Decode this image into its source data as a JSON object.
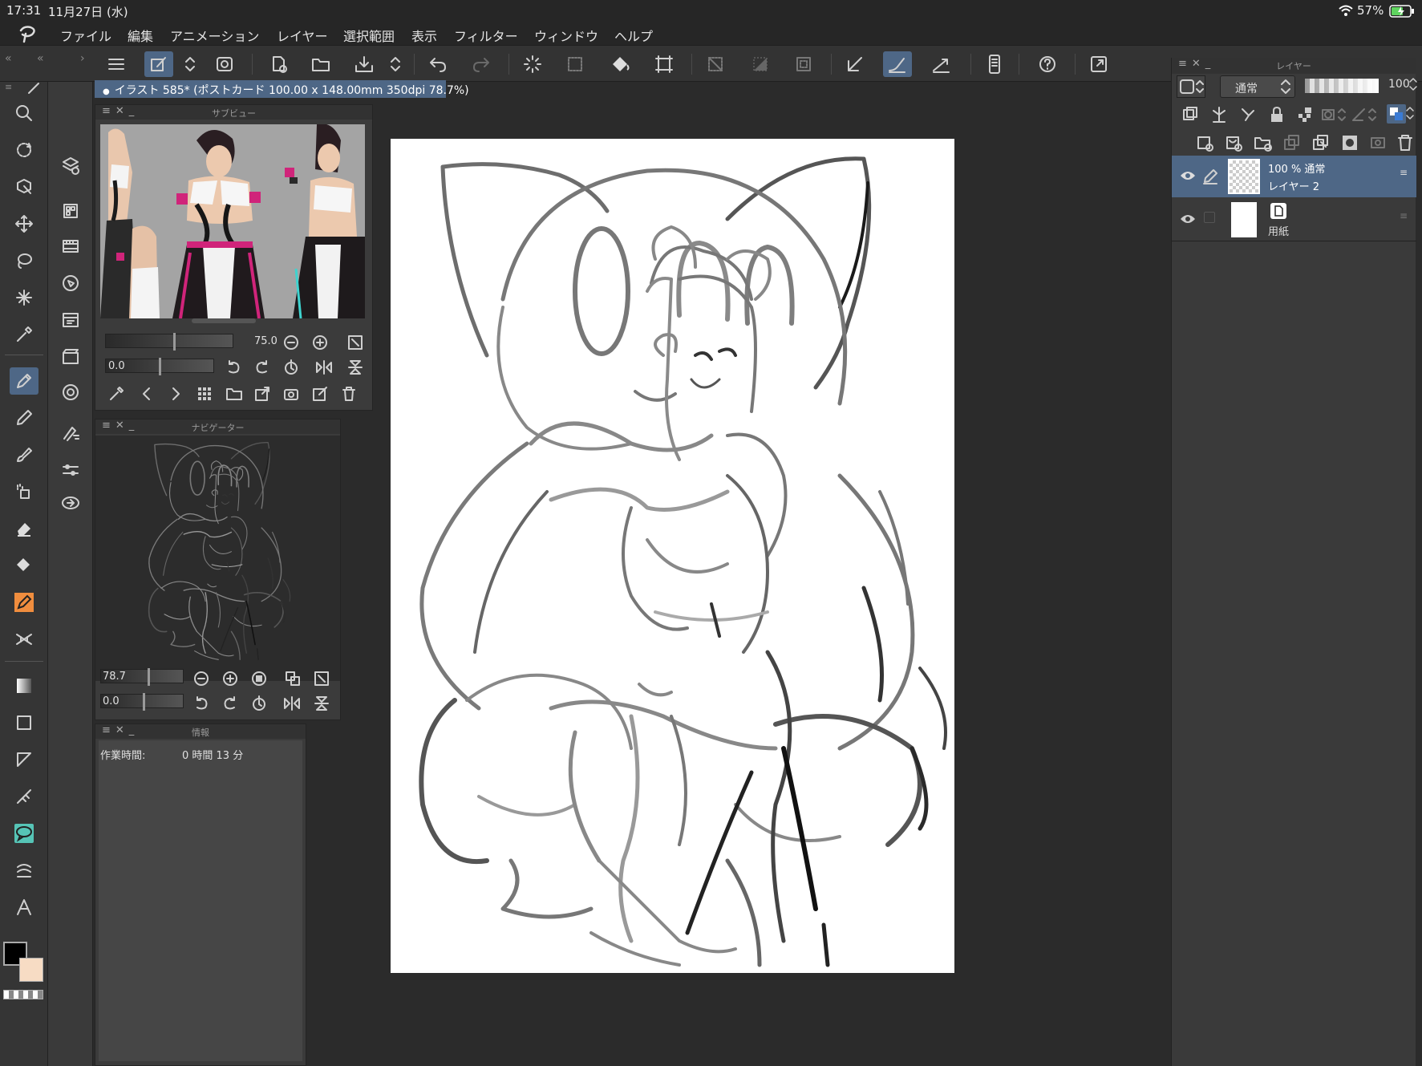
{
  "status": {
    "time": "17:31",
    "date": "11月27日 (水)",
    "battery": "57%"
  },
  "menu": [
    "ファイル",
    "編集",
    "アニメーション",
    "レイヤー",
    "選択範囲",
    "表示",
    "フィルター",
    "ウィンドウ",
    "ヘルプ"
  ],
  "document": {
    "tab_title": "イラスト 585* (ポストカード 100.00 x 148.00mm 350dpi 78.7%)"
  },
  "subview": {
    "title": "サブビュー",
    "zoom": "75.0",
    "rotation": "0.0"
  },
  "navigator": {
    "title": "ナビゲーター",
    "zoom": "78.7",
    "rotation": "0.0"
  },
  "info": {
    "title": "情報",
    "label": "作業時間:",
    "value": "0 時間 13 分"
  },
  "layers": {
    "title": "レイヤー",
    "blend_mode": "通常",
    "opacity": "100",
    "items": [
      {
        "meta": "100 % 通常",
        "name": "レイヤー 2",
        "selected": true
      },
      {
        "meta": "",
        "name": "用紙",
        "selected": false
      }
    ]
  },
  "colors": {
    "main": "#000000",
    "sub": "#f7dcc4",
    "accent": "#4e6786"
  }
}
